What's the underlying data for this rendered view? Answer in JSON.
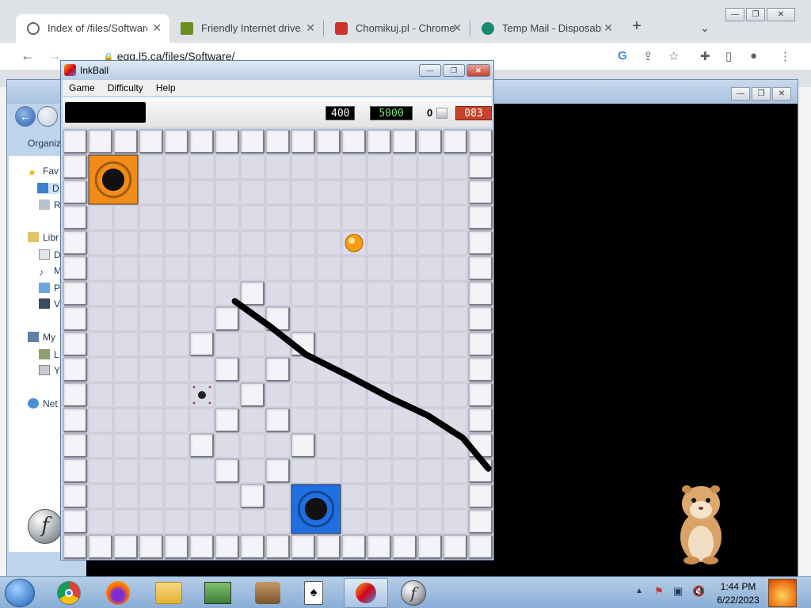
{
  "chrome": {
    "tabs": [
      {
        "title": "Index of /files/Software/",
        "favicon": "globe-icon",
        "active": true
      },
      {
        "title": "Friendly Internet drive -",
        "favicon": "drive-icon",
        "active": false
      },
      {
        "title": "Chomikuj.pl - Chrome W",
        "favicon": "chomikuj-icon",
        "active": false
      },
      {
        "title": "Temp Mail - Disposable",
        "favicon": "tempmail-icon",
        "active": false
      }
    ],
    "new_tab": "+",
    "url": "egg.l5.ca/files/Software/",
    "window_buttons": [
      "—",
      "❐",
      "✕"
    ]
  },
  "explorer": {
    "organize_label": "Organiz",
    "items": [
      {
        "label": "Fav",
        "icon": "star-icon"
      },
      {
        "label": "D",
        "icon": "desktop-folder-icon"
      },
      {
        "label": "R",
        "icon": "recent-icon"
      },
      {
        "label": "Libr",
        "icon": "library-icon"
      },
      {
        "label": "D",
        "icon": "documents-icon"
      },
      {
        "label": "M",
        "icon": "music-icon"
      },
      {
        "label": "P",
        "icon": "pictures-icon"
      },
      {
        "label": "V",
        "icon": "videos-icon"
      },
      {
        "label": "My",
        "icon": "computer-icon"
      },
      {
        "label": "L",
        "icon": "drive-icon"
      },
      {
        "label": "Y",
        "icon": "removable-drive-icon"
      },
      {
        "label": "Net",
        "icon": "network-icon"
      }
    ],
    "flash_glyph": "f"
  },
  "inkball": {
    "title": "InkBall",
    "menu": [
      "Game",
      "Difficulty",
      "Help"
    ],
    "scores": {
      "points": "400",
      "target": "5000",
      "balls": "0",
      "timer": "083"
    },
    "colors": {
      "orange_hole": "#f28c18",
      "blue_hole": "#1f6fe0",
      "ball": "#f39c12",
      "ink": "#000000"
    },
    "holes": [
      {
        "color": "orange",
        "col": 1,
        "row": 1,
        "size": 2
      },
      {
        "color": "blue",
        "col": 9,
        "row": 14,
        "size": 2
      }
    ],
    "ball": {
      "color": "orange",
      "col": 11.5,
      "row": 4.5
    },
    "spawn": {
      "col": 5.5,
      "row": 10.5
    },
    "wall_blocks": [
      [
        7,
        6
      ],
      [
        6,
        7
      ],
      [
        8,
        7
      ],
      [
        5,
        8
      ],
      [
        9,
        8
      ],
      [
        6,
        9
      ],
      [
        8,
        9
      ],
      [
        7,
        10
      ],
      [
        6,
        11
      ],
      [
        8,
        11
      ],
      [
        5,
        12
      ],
      [
        9,
        12
      ],
      [
        6,
        13
      ],
      [
        8,
        13
      ],
      [
        7,
        14
      ]
    ],
    "ink_stroke": [
      [
        6.8,
        6.8
      ],
      [
        8.2,
        7.8
      ],
      [
        9.6,
        8.9
      ],
      [
        11.2,
        9.7
      ],
      [
        12.9,
        10.6
      ],
      [
        14.4,
        11.3
      ],
      [
        15.8,
        12.2
      ],
      [
        16.8,
        13.4
      ]
    ]
  },
  "taskbar": {
    "start_icon": "windows-start-icon",
    "pinned": [
      {
        "name": "chrome-icon"
      },
      {
        "name": "firefox-icon"
      },
      {
        "name": "explorer-icon"
      },
      {
        "name": "monitor-icon"
      },
      {
        "name": "games-icon"
      },
      {
        "name": "solitaire-icon"
      },
      {
        "name": "inkball-icon",
        "active": true
      },
      {
        "name": "flash-icon"
      }
    ],
    "time": "1:44 PM",
    "date": "6/22/2023"
  }
}
